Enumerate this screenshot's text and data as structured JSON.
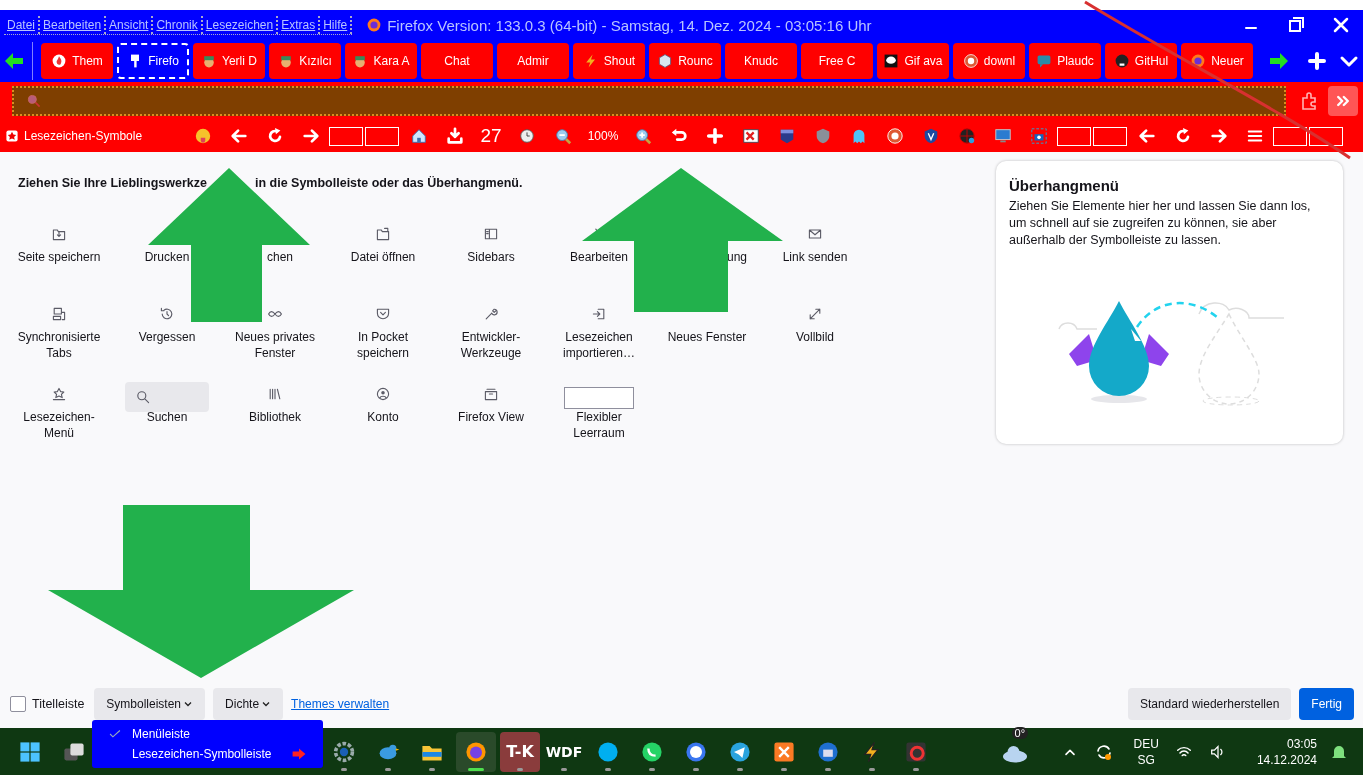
{
  "menu_bar": [
    "Datei",
    "Bearbeiten",
    "Ansicht",
    "Chronik",
    "Lesezeichen",
    "Extras",
    "Hilfe"
  ],
  "window": {
    "title": "Firefox Version: 133.0.3 (64-bit) -  Samstag, 14. Dez. 2024 - 03:05:16 Uhr"
  },
  "tabs": [
    {
      "label": "Them",
      "selected": false
    },
    {
      "label": "Firefo",
      "selected": true
    },
    {
      "label": "Yerli D",
      "selected": false
    },
    {
      "label": "Kızılcı",
      "selected": false
    },
    {
      "label": "Kara A",
      "selected": false
    },
    {
      "label": "Chat",
      "selected": false
    },
    {
      "label": "Admir",
      "selected": false
    },
    {
      "label": "Shout",
      "selected": false
    },
    {
      "label": "Rounc",
      "selected": false
    },
    {
      "label": "Knudc",
      "selected": false
    },
    {
      "label": "Free C",
      "selected": false
    },
    {
      "label": "Gif ava",
      "selected": false
    },
    {
      "label": "downl",
      "selected": false
    },
    {
      "label": "Plaudc",
      "selected": false
    },
    {
      "label": "GitHul",
      "selected": false
    },
    {
      "label": "Neuer",
      "selected": false
    }
  ],
  "bookmarks_toolbar": {
    "folder": "Lesezeichen-Symbole",
    "downloads_count": "27",
    "zoom": "100%"
  },
  "customize": {
    "heading_start": "Ziehen Sie Ihre Lieblingswerkze",
    "heading_end": "in die Symbolleiste oder das Überhangmenü.",
    "items": [
      {
        "label": "Seite speichern"
      },
      {
        "label": "Drucken"
      },
      {
        "label": "chen"
      },
      {
        "label": "Datei öffnen"
      },
      {
        "label": "Sidebars"
      },
      {
        "label": "Bearbeiten"
      },
      {
        "label": "ung"
      },
      {
        "label": "Link senden"
      },
      {
        "label": "Synchronisierte Tabs"
      },
      {
        "label": "Vergessen"
      },
      {
        "label": "Neues privates Fenster"
      },
      {
        "label": "In Pocket speichern"
      },
      {
        "label": "Entwickler-Werkzeuge"
      },
      {
        "label": "Lesezeichen importieren…"
      },
      {
        "label": "Neues Fenster"
      },
      {
        "label": "Vollbild"
      },
      {
        "label": "Lesezeichen-Menü"
      },
      {
        "label": "Suchen"
      },
      {
        "label": "Bibliothek"
      },
      {
        "label": "Konto"
      },
      {
        "label": "Firefox View"
      },
      {
        "label": "Flexibler Leerraum"
      }
    ]
  },
  "overflow_panel": {
    "title": "Überhangmenü",
    "text": "Ziehen Sie Elemente hier her und lassen Sie dann los, um schnell auf sie zugreifen zu können, sie aber außerhalb der Symbolleiste zu lassen."
  },
  "footer": {
    "title_bar_checkbox": {
      "label": "Titelleiste",
      "checked": false
    },
    "toolbars_button": "Symbolleisten",
    "density_button": "Dichte",
    "themes_link": "Themes verwalten",
    "restore_button": "Standard wiederherstellen",
    "done_button": "Fertig"
  },
  "toolbars_menu": [
    {
      "label": "Menüleiste",
      "checked": true
    },
    {
      "label": "Lesezeichen-Symbolleiste",
      "checked": false
    }
  ],
  "taskbar": {
    "app_labels": [
      "T-K",
      "WDF"
    ],
    "weather": "0°",
    "language": "DEU",
    "layout": "SG",
    "time": "03:05",
    "date": "14.12.2024"
  }
}
